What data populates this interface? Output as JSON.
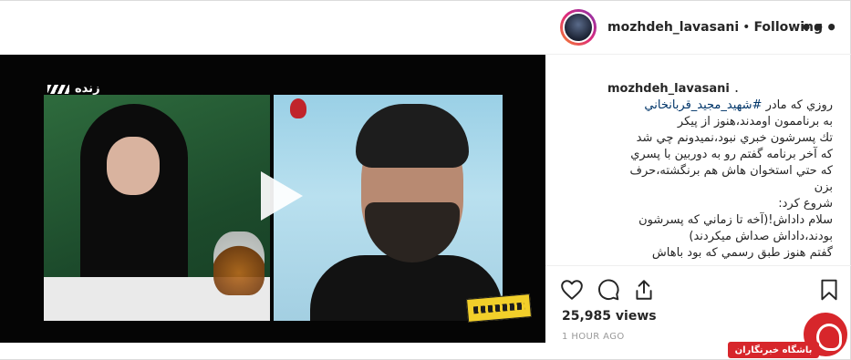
{
  "video": {
    "channel_label": "زنده",
    "play_icon": "play-icon"
  },
  "header": {
    "username": "mozhdeh_lavasani",
    "separator": "•",
    "follow_status": "Following",
    "more_label": "•••",
    "more_icon": "more-options-icon"
  },
  "caption": {
    "username": "mozhdeh_lavasani",
    "suffix": ".",
    "prefix": "روزي که مادر ",
    "hashtag": "#شهيد_مجيد_قربانخاني",
    "body": "به برناممون اومدند،هنوز از پيکر\nتك پسرشون خبري نبود،نميدونم چي شد\nكه آخر برنامه گفتم رو به دوربين با پسري\nكه حتي استخوان هاش هم برنگشته،حرف\nبزن\nشروع کرد:\nسلام داداش!(آخه تا زماني که پسرشون\nبودند،داداش صداش ميکردند)\nگفتم هنوز طبق رسمي که بود باهاش"
  },
  "actions": {
    "like_icon": "heart-icon",
    "comment_icon": "comment-icon",
    "share_icon": "share-icon",
    "save_icon": "bookmark-icon"
  },
  "stats": {
    "views": "25,985 views",
    "time": "1 HOUR AGO"
  },
  "watermark": {
    "text": "باشگاه خبرنگاران"
  },
  "colors": {
    "link": "#003569",
    "muted": "#999999",
    "brand_red": "#d7262b"
  }
}
